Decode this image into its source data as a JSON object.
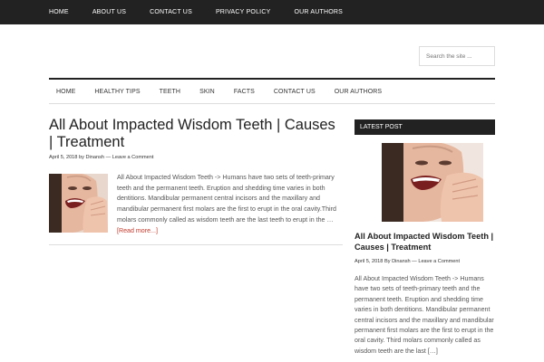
{
  "top_nav": [
    "HOME",
    "ABOUT US",
    "CONTACT US",
    "PRIVACY POLICY",
    "OUR AUTHORS"
  ],
  "search": {
    "placeholder": "Search the site ..."
  },
  "main_nav": [
    "HOME",
    "HEALTHY TIPS",
    "TEETH",
    "SKIN",
    "FACTS",
    "CONTACT US",
    "OUR AUTHORS"
  ],
  "post": {
    "title": "All About Impacted Wisdom Teeth | Causes | Treatment",
    "date": "April 5, 2018",
    "by": "by",
    "author": "Dinansh",
    "sep": "—",
    "comment": "Leave a Comment",
    "excerpt": "All About Impacted Wisdom Teeth -> Humans have two sets of teeth-primary teeth and the permanent teeth. Eruption and shedding time varies in both dentitions. Mandibular permanent central incisors and the maxillary and mandibular permanent first molars are the first to erupt in the oral cavity.Third molars commonly called as wisdom teeth are the last teeth to erupt in the …",
    "read_more": "[Read more...]"
  },
  "sidebar": {
    "widget_title": "LATEST POST",
    "title": "All About Impacted Wisdom Teeth | Causes | Treatment",
    "date": "April 5, 2018",
    "by": "By",
    "author": "Dinansh",
    "sep": "—",
    "comment": "Leave a Comment",
    "excerpt": "All About Impacted Wisdom Teeth -> Humans have two sets of teeth-primary teeth and the permanent teeth. Eruption and shedding time varies in both dentitions. Mandibular permanent central incisors and the maxillary and mandibular permanent first molars are the first to erupt in the oral cavity. Third molars commonly called as wisdom teeth are the last […]"
  }
}
